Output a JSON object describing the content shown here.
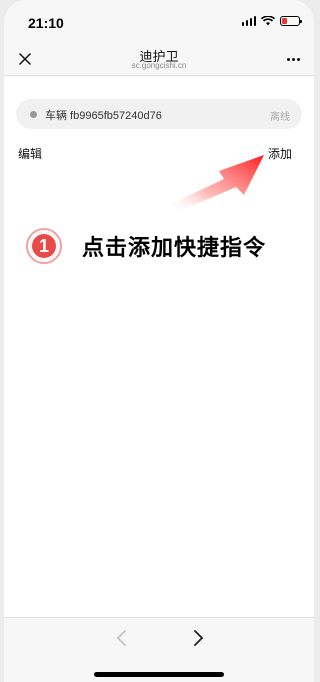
{
  "status_bar": {
    "time": "21:10",
    "icons": [
      "signal-icon",
      "wifi-icon",
      "battery-icon"
    ]
  },
  "header": {
    "title": "迪护卫",
    "subtitle": "sc.gongcishi.cn",
    "close_icon": "close-icon",
    "more_icon": "more-icon"
  },
  "vehicle": {
    "name": "车辆 fb9965fb57240d76",
    "status": "离线",
    "status_color": "#999999"
  },
  "actions": {
    "edit_label": "编辑",
    "add_label": "添加"
  },
  "overlay": {
    "step_number": "1",
    "instruction": "点击添加快捷指令",
    "accent_color": "#e84a4a"
  },
  "bottom_nav": {
    "back_icon": "chevron-left-icon",
    "forward_icon": "chevron-right-icon"
  }
}
